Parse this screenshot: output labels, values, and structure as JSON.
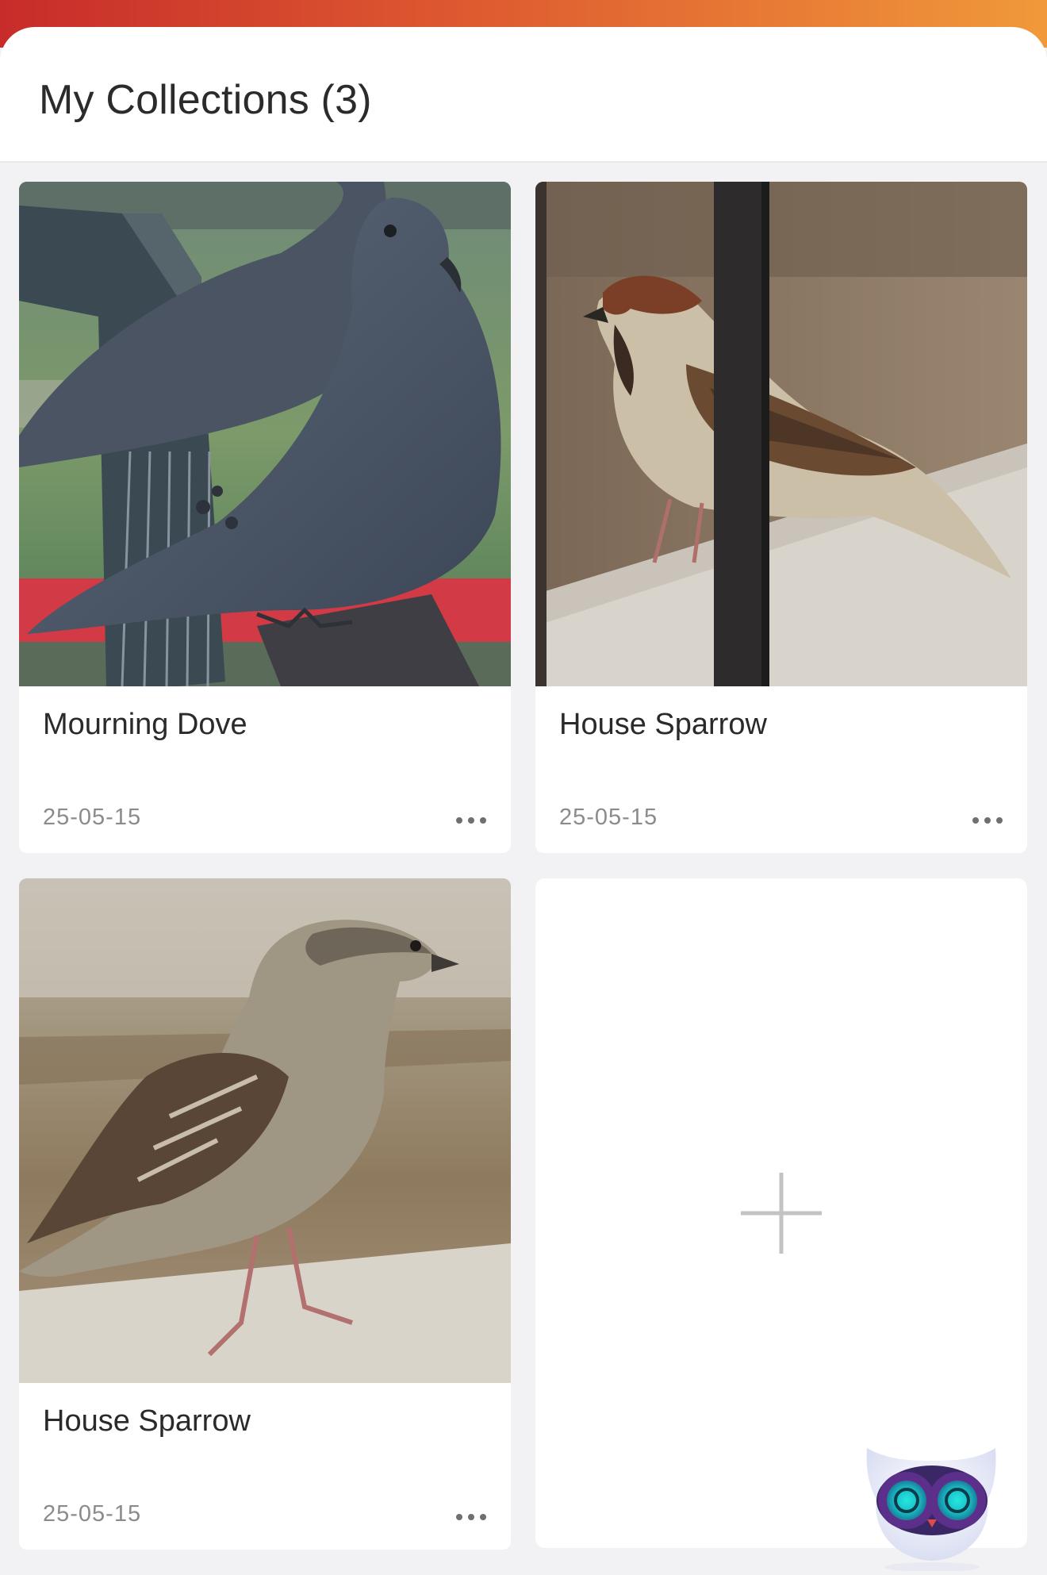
{
  "header": {
    "title": "My Collections (3)"
  },
  "collections": [
    {
      "name": "Mourning Dove",
      "date": "25-05-15",
      "photo": "mourning-dove-photo"
    },
    {
      "name": "House Sparrow",
      "date": "25-05-15",
      "photo": "house-sparrow-male-photo"
    },
    {
      "name": "House Sparrow",
      "date": "25-05-15",
      "photo": "house-sparrow-female-photo"
    }
  ],
  "add_card": {
    "icon": "plus-icon"
  },
  "assistant": {
    "icon": "owl-mascot-icon"
  },
  "colors": {
    "gradient_start": "#c72c2a",
    "gradient_end": "#f0993a",
    "background": "#f2f2f4",
    "mascot_eyes": "#27e6e0"
  }
}
